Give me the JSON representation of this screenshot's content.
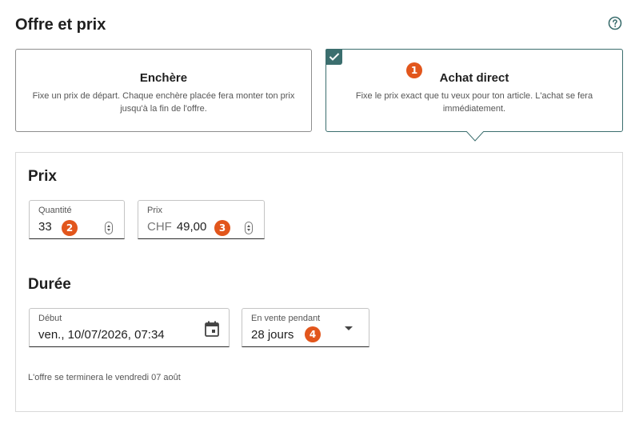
{
  "section_title": "Offre et prix",
  "icons": {
    "help": "help-circle-icon",
    "check": "check-icon",
    "calendar": "calendar-icon",
    "dropdown": "chevron-down-icon",
    "stepper": "stepper-icon"
  },
  "colors": {
    "accent": "#3b6e6e",
    "badge": "#e2561c",
    "border": "#8e8e8e"
  },
  "cards": {
    "auction": {
      "title": "Enchère",
      "desc": "Fixe un prix de départ. Chaque enchère placée fera monter ton prix jusqu'à la fin de l'offre."
    },
    "direct": {
      "title": "Achat direct",
      "desc": "Fixe le prix exact que tu veux pour ton article. L'achat se fera immédiatement.",
      "selected": true
    }
  },
  "badges": {
    "b1": "1",
    "b2": "2",
    "b3": "3",
    "b4": "4"
  },
  "price_section": {
    "title": "Prix",
    "quantity": {
      "label": "Quantité",
      "value": "33"
    },
    "price": {
      "label": "Prix",
      "currency": "CHF",
      "value": "49,00"
    }
  },
  "duration_section": {
    "title": "Durée",
    "start": {
      "label": "Début",
      "value": "ven., 10/07/2026, 07:34"
    },
    "period": {
      "label": "En vente pendant",
      "value": "28 jours"
    }
  },
  "end_note": "L'offre se terminera le vendredi 07 août"
}
